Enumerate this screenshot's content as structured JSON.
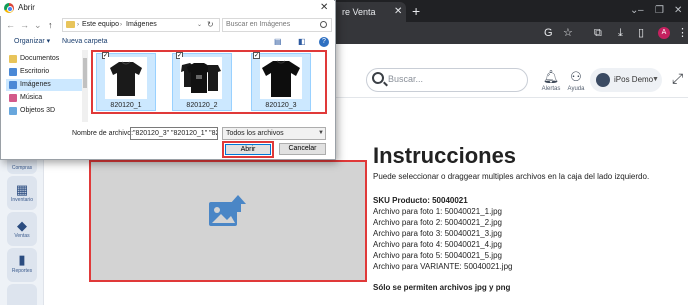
{
  "browser": {
    "tab_title": "re Venta",
    "tab_close_icon": "close-icon",
    "new_tab_symbol": "+",
    "window_controls": {
      "minimize": "–",
      "restore": "❐",
      "close": "✕"
    },
    "profile_initial": "A",
    "profile_color": "#c5215f"
  },
  "app": {
    "search_placeholder": "Buscar...",
    "alerts_label": "Alertas",
    "help_label": "Ayuda",
    "user_name": "iPos Demo"
  },
  "sidebar": {
    "items": [
      {
        "label": "Compras",
        "icon": "cart-icon"
      },
      {
        "label": "Inventario",
        "icon": "grid-icon"
      },
      {
        "label": "Ventas",
        "icon": "tag-icon"
      },
      {
        "label": "Reportes",
        "icon": "bar-chart-icon"
      }
    ]
  },
  "instructions": {
    "title": "Instrucciones",
    "intro": "Puede seleccionar o draggear multiples archivos en la caja del lado izquierdo.",
    "sku": "SKU Producto: 50040021",
    "lines": [
      "Archivo para foto 1: 50040021_1.jpg",
      "Archivo para foto 2: 50040021_2.jpg",
      "Archivo para foto 3: 50040021_3.jpg",
      "Archivo para foto 4: 50040021_4.jpg",
      "Archivo para foto 5: 50040021_5.jpg",
      "Archivo para VARIANTE: 50040021.jpg"
    ],
    "note": "Sólo se permiten archivos jpg y png"
  },
  "dialog": {
    "title": "Abrir",
    "path": [
      "Este equipo",
      "Imágenes"
    ],
    "search_placeholder": "Buscar en Imágenes",
    "organize_label": "Organizar ▾",
    "new_folder_label": "Nueva carpeta",
    "tree": [
      {
        "label": "Documentos",
        "selected": false
      },
      {
        "label": "Escritorio",
        "selected": false
      },
      {
        "label": "Imágenes",
        "selected": true
      },
      {
        "label": "Música",
        "selected": false
      },
      {
        "label": "Objetos 3D",
        "selected": false
      }
    ],
    "files": [
      {
        "name": "820120_1",
        "checked": "✓"
      },
      {
        "name": "820120_2",
        "checked": "✓"
      },
      {
        "name": "820120_3",
        "checked": "✓"
      }
    ],
    "filename_label": "Nombre de archivo:",
    "filename_value": "\"820120_3\" \"820120_1\" \"82",
    "file_type": "Todos los archivos",
    "open_button": "Abrir",
    "cancel_button": "Cancelar"
  }
}
